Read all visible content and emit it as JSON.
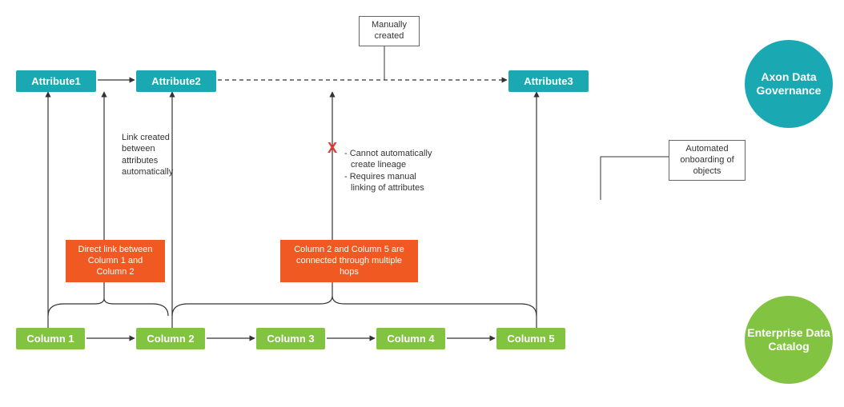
{
  "attributes": {
    "a1": "Attribute1",
    "a2": "Attribute2",
    "a3": "Attribute3"
  },
  "columns": {
    "c1": "Column 1",
    "c2": "Column 2",
    "c3": "Column 3",
    "c4": "Column 4",
    "c5": "Column 5"
  },
  "annotations": {
    "manually_created": "Manually created",
    "link_auto": "Link created between attributes automatically",
    "direct_link": "Direct link between Column 1 and Column 2",
    "multi_hop": "Column 2 and Column 5 are connected through multiple hops",
    "cannot_auto_1": "- Cannot automatically",
    "cannot_auto_2": "create lineage",
    "cannot_auto_3": "- Requires manual",
    "cannot_auto_4": "linking of attributes",
    "automated_onboarding": "Automated onboarding of objects",
    "red_x": "X"
  },
  "legend": {
    "axon": "Axon Data Governance",
    "edc": "Enterprise Data Catalog"
  },
  "colors": {
    "attr": "#1aa8b3",
    "col": "#82c341",
    "orange": "#f05a22",
    "red": "#e53935"
  }
}
